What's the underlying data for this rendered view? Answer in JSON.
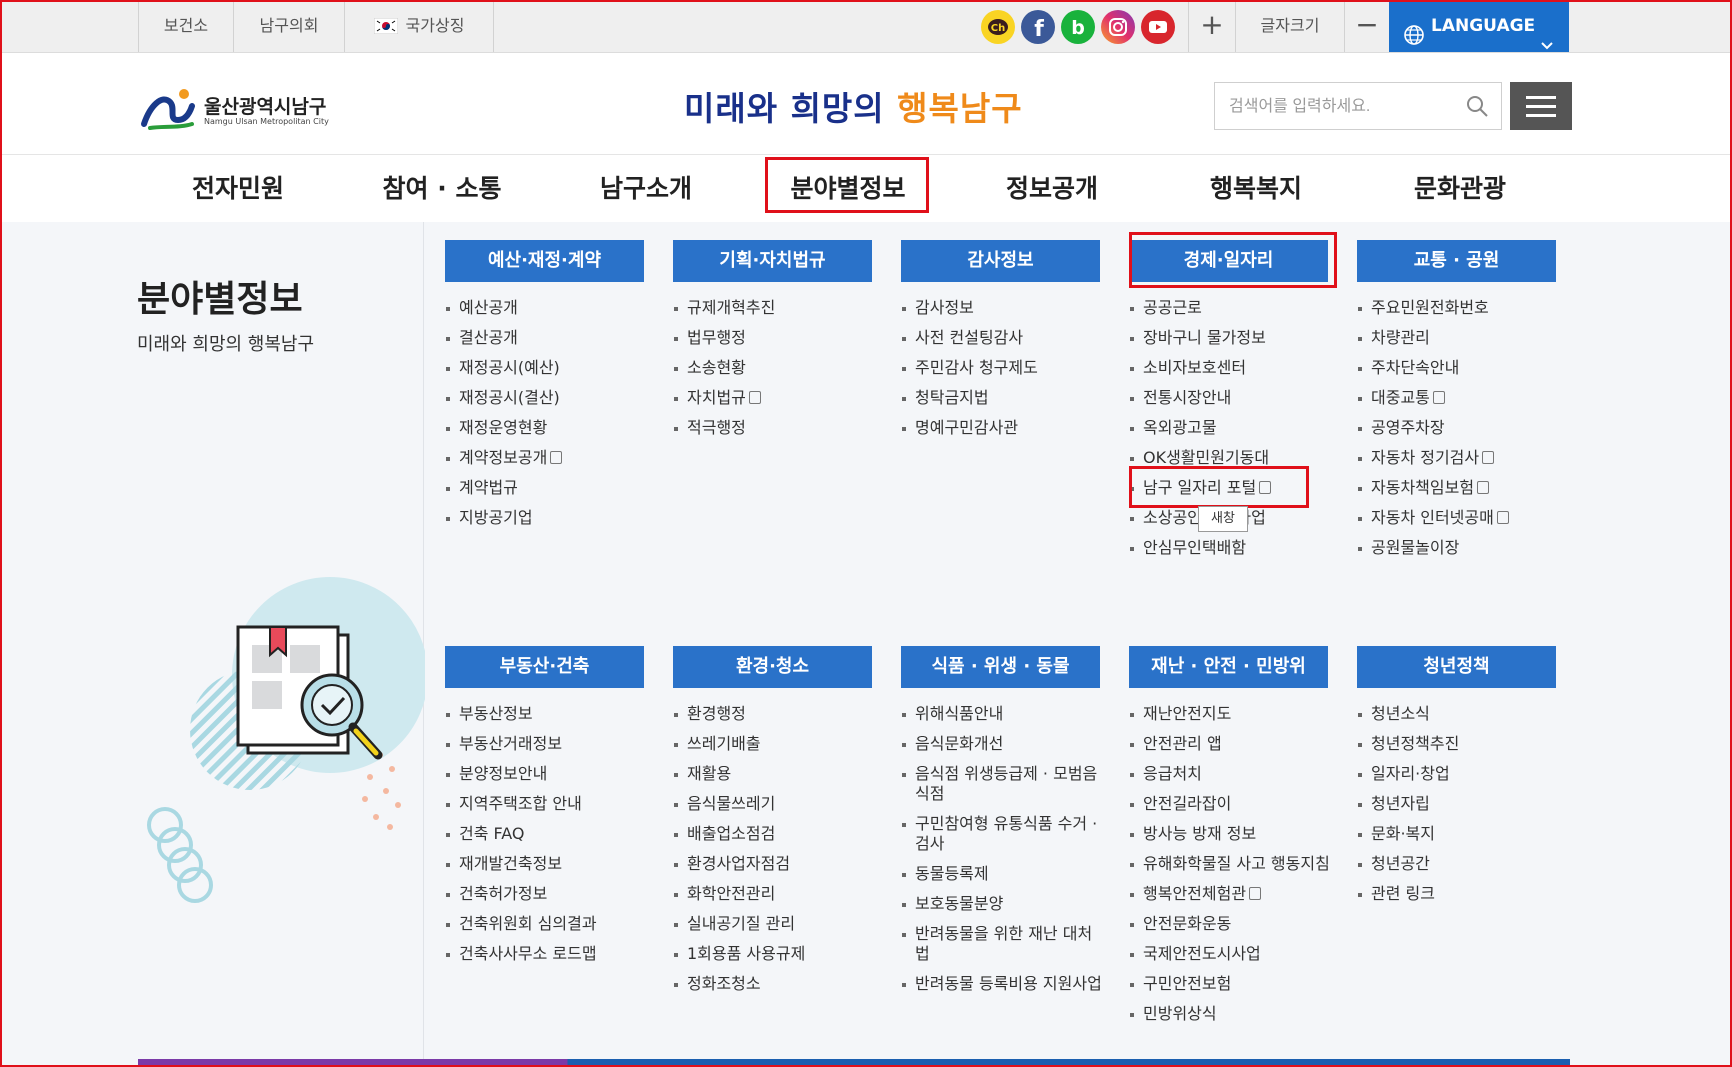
{
  "topbar": {
    "links": [
      "보건소",
      "남구의회",
      "국가상징"
    ],
    "font_size_label": "글자크기",
    "zoom_in": "+",
    "zoom_out": "−",
    "language_label": "LANGUAGE"
  },
  "header": {
    "logo_name": "울산광역시남구",
    "logo_sub": "Namgu Ulsan Metropolitan City",
    "slogan_part1": "미래와 희망의",
    "slogan_part2": "행복남구",
    "search_placeholder": "검색어를 입력하세요."
  },
  "nav": [
    "전자민원",
    "참여 · 소통",
    "남구소개",
    "분야별정보",
    "정보공개",
    "행복복지",
    "문화관광"
  ],
  "section": {
    "title": "분야별정보",
    "subtitle": "미래와 희망의 행복남구"
  },
  "categories_row1": [
    {
      "title": "예산·재정·계약",
      "items": [
        "예산공개",
        "결산공개",
        "재정공시(예산)",
        "재정공시(결산)",
        "재정운영현황",
        "계약정보공개",
        "계약법규",
        "지방공기업"
      ]
    },
    {
      "title": "기획·자치법규",
      "items": [
        "규제개혁추진",
        "법무행정",
        "소송현황",
        "자치법규",
        "적극행정"
      ]
    },
    {
      "title": "감사정보",
      "items": [
        "감사정보",
        "사전 컨설팅감사",
        "주민감사 청구제도",
        "청탁금지법",
        "명예구민감사관"
      ]
    },
    {
      "title": "경제·일자리",
      "items": [
        "공공근로",
        "장바구니 물가정보",
        "소비자보호센터",
        "전통시장안내",
        "옥외광고물",
        "OK생활민원기동대",
        "남구 일자리 포털",
        "소상공인 지원사업",
        "안심무인택배함"
      ]
    },
    {
      "title": "교통 · 공원",
      "items": [
        "주요민원전화번호",
        "차량관리",
        "주차단속안내",
        "대중교통",
        "공영주차장",
        "자동차 정기검사",
        "자동차책임보험",
        "자동차 인터넷공매",
        "공원물놀이장"
      ]
    }
  ],
  "categories_row2": [
    {
      "title": "부동산·건축",
      "items": [
        "부동산정보",
        "부동산거래정보",
        "분양정보안내",
        "지역주택조합 안내",
        "건축 FAQ",
        "재개발건축정보",
        "건축허가정보",
        "건축위원회 심의결과",
        "건축사사무소 로드맵"
      ]
    },
    {
      "title": "환경·청소",
      "items": [
        "환경행정",
        "쓰레기배출",
        "재활용",
        "음식물쓰레기",
        "배출업소점검",
        "환경사업자점검",
        "화학안전관리",
        "실내공기질 관리",
        "1회용품 사용규제",
        "정화조청소"
      ]
    },
    {
      "title": "식품 · 위생 · 동물",
      "items": [
        "위해식품안내",
        "음식문화개선",
        "음식점 위생등급제 · 모범음식점",
        "구민참여형 유통식품 수거 · 검사",
        "동물등록제",
        "보호동물분양",
        "반려동물을 위한 재난 대처법",
        "반려동물 등록비용 지원사업"
      ]
    },
    {
      "title": "재난 · 안전 · 민방위",
      "items": [
        "재난안전지도",
        "안전관리 앱",
        "응급처치",
        "안전길라잡이",
        "방사능 방재 정보",
        "유해화학물질 사고 행동지침",
        "행복안전체험관",
        "안전문화운동",
        "국제안전도시사업",
        "구민안전보험",
        "민방위상식"
      ]
    },
    {
      "title": "청년정책",
      "items": [
        "청년소식",
        "청년정책추진",
        "일자리·창업",
        "청년자립",
        "문화·복지",
        "청년공간",
        "관련 링크"
      ]
    }
  ],
  "tooltip": "새창",
  "colors": {
    "accent": "#2a72c9",
    "highlight": "#e0101a",
    "language_bg": "#1a6fcb"
  }
}
